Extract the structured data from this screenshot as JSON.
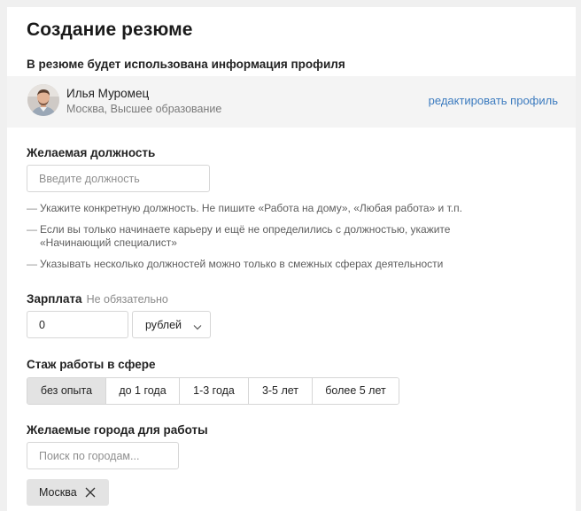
{
  "page": {
    "title": "Создание резюме",
    "profile_hint": "В резюме будет использована информация профиля"
  },
  "profile": {
    "name": "Илья Муромец",
    "details": "Москва, Высшее образование",
    "edit_link": "редактировать профиль"
  },
  "position": {
    "label": "Желаемая должность",
    "placeholder": "Введите должность",
    "value": "",
    "tips": [
      "Укажите конкретную должность. Не пишите «Работа на дому», «Любая работа» и т.п.",
      "Если вы только начинаете карьеру и ещё не определились с должностью, укажите «Начинающий специалист»",
      "Указывать несколько должностей можно только в смежных сферах деятельности"
    ]
  },
  "salary": {
    "label": "Зарплата",
    "optional": "Не обязательно",
    "value": "0",
    "currency": "рублей"
  },
  "experience": {
    "label": "Стаж работы в сфере",
    "options": [
      "без опыта",
      "до 1 года",
      "1-3 года",
      "3-5 лет",
      "более 5 лет"
    ],
    "selected": "без опыта"
  },
  "cities": {
    "label": "Желаемые города для работы",
    "placeholder": "Поиск по городам...",
    "selected": [
      "Москва"
    ]
  },
  "colors": {
    "link": "#3c7bbf",
    "active_segment": "#e3e3e3",
    "profile_strip": "#f4f4f4"
  },
  "icons": {
    "select_chevron": "chevron-down-icon",
    "tag_remove": "close-icon"
  }
}
